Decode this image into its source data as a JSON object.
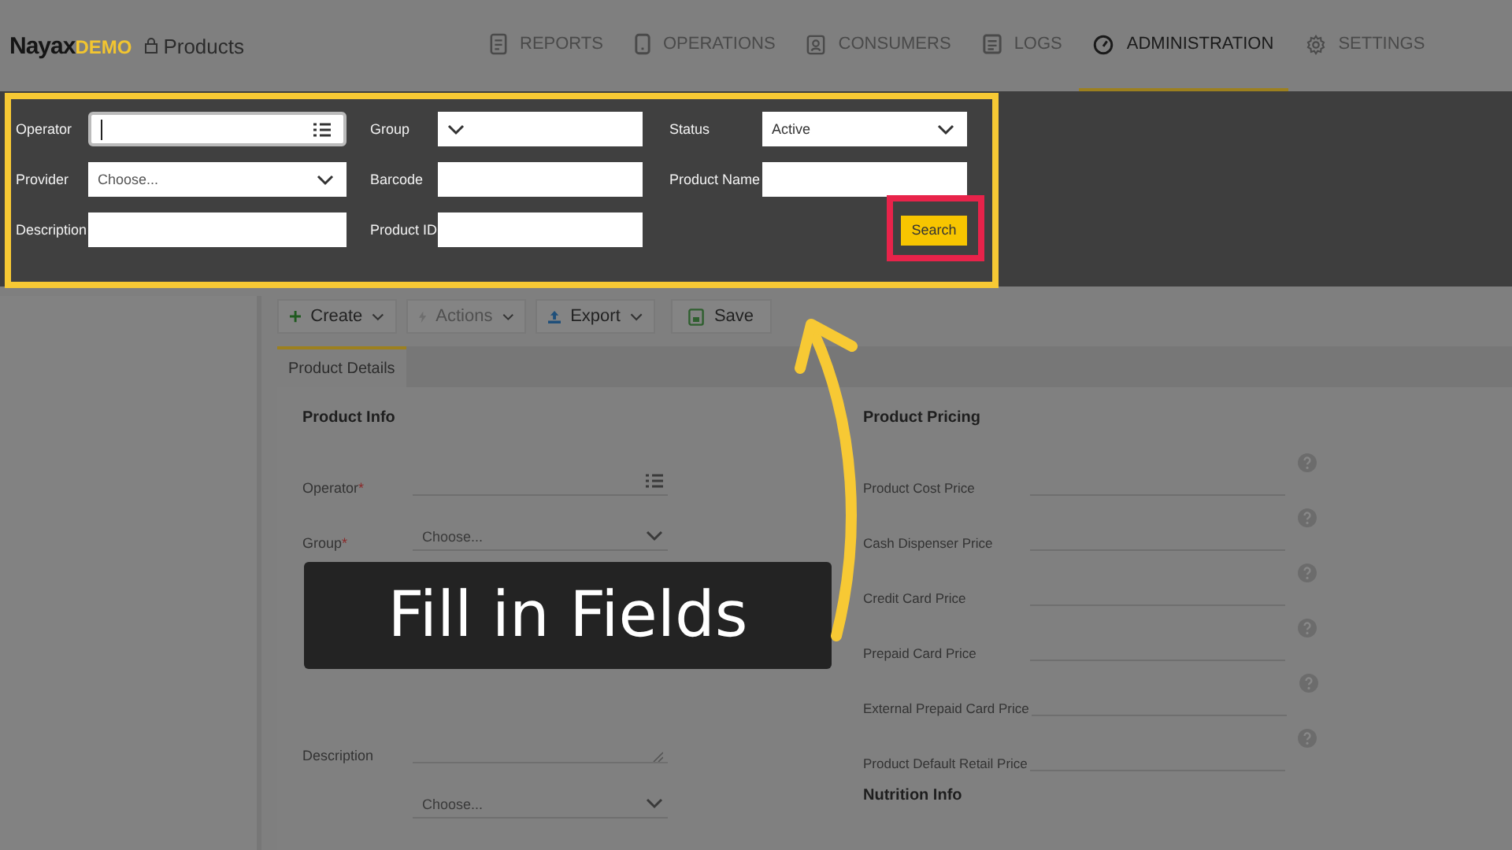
{
  "header": {
    "logo": "Nayax",
    "logo_badge": "DEMO",
    "page": "Products",
    "nav": [
      {
        "label": "REPORTS",
        "selected": false
      },
      {
        "label": "OPERATIONS",
        "selected": false
      },
      {
        "label": "CONSUMERS",
        "selected": false
      },
      {
        "label": "LOGS",
        "selected": false
      },
      {
        "label": "ADMINISTRATION",
        "selected": true
      },
      {
        "label": "SETTINGS",
        "selected": false
      }
    ]
  },
  "filters": {
    "fields": [
      {
        "label": "Operator",
        "kind": "list",
        "focused": true
      },
      {
        "label": "Group",
        "kind": "select",
        "focused": false
      },
      {
        "label": "Status",
        "kind": "select",
        "value": "Active",
        "focused": false
      },
      {
        "label": "Provider",
        "kind": "select",
        "placeholder": "Choose...",
        "focused": false
      },
      {
        "label": "Barcode",
        "kind": "text",
        "focused": false
      },
      {
        "label": "Product Name",
        "kind": "text",
        "focused": false
      },
      {
        "label": "Description",
        "kind": "text",
        "focused": false
      },
      {
        "label": "Product ID",
        "kind": "text",
        "focused": false
      }
    ],
    "search_button": "Search"
  },
  "toolbar": [
    {
      "label": "Create",
      "dropdown": true,
      "disabled": false
    },
    {
      "label": "Actions",
      "dropdown": true,
      "disabled": true
    },
    {
      "label": "Export",
      "dropdown": true,
      "disabled": false
    },
    {
      "label": "Save",
      "dropdown": false,
      "disabled": false
    }
  ],
  "tabs": [
    {
      "label": "Product Details",
      "selected": true
    }
  ],
  "product_info": {
    "title": "Product Info",
    "fields": [
      {
        "label": "Operator",
        "required_mark": "*",
        "kind": "list"
      },
      {
        "label": "Group",
        "required_mark": "*",
        "kind": "select",
        "placeholder": "Choose..."
      },
      {
        "label": "Description",
        "kind": "textarea"
      },
      {
        "kind": "select",
        "placeholder": "Choose..."
      }
    ]
  },
  "product_pricing": {
    "title": "Product Pricing",
    "fields": [
      {
        "label": "Product Cost Price"
      },
      {
        "label": "Cash Dispenser Price"
      },
      {
        "label": "Credit Card Price"
      },
      {
        "label": "Prepaid Card Price"
      },
      {
        "label": "External Prepaid Card Price"
      },
      {
        "label": "Product Default Retail Price"
      }
    ]
  },
  "nutrition_info": {
    "title": "Nutrition Info"
  },
  "callout": "Fill in Fields"
}
